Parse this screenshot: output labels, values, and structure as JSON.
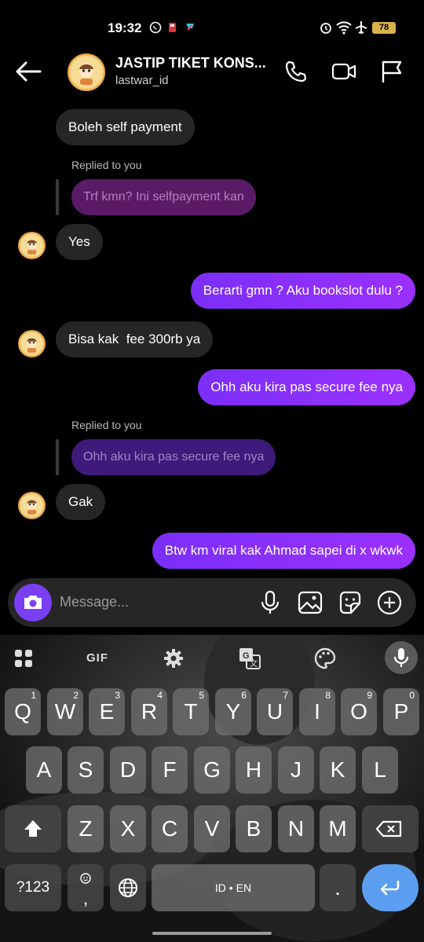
{
  "status_bar": {
    "time": "19:32",
    "battery": "78"
  },
  "header": {
    "title": "JASTIP TIKET KONS...",
    "subtitle": "lastwar_id",
    "icons": [
      "back-arrow-icon",
      "phone-icon",
      "video-icon",
      "flag-icon"
    ]
  },
  "messages": [
    {
      "dir": "in",
      "text": "Boleh self payment"
    },
    {
      "dir": "in",
      "replied_label": "Replied to you",
      "quoted": "Trf kmn? Ini selfpayment kan",
      "text": "Yes"
    },
    {
      "dir": "out",
      "text": "Berarti gmn ? Aku bookslot dulu ?"
    },
    {
      "dir": "in",
      "text": "Bisa kak  fee 300rb ya"
    },
    {
      "dir": "out",
      "text": "Ohh aku kira pas secure fee nya"
    },
    {
      "dir": "in",
      "replied_label": "Replied to you",
      "quoted": "Ohh aku kira pas secure fee nya",
      "text": "Gak"
    },
    {
      "dir": "out",
      "text": "Btw km viral kak Ahmad sapei di x wkwk"
    }
  ],
  "composer": {
    "placeholder": "Message...",
    "icons": [
      "camera-icon",
      "mic-icon",
      "image-icon",
      "sticker-icon",
      "plus-icon"
    ]
  },
  "keyboard": {
    "toolbar": [
      "grid-icon",
      "GIF",
      "gear-icon",
      "translate-icon",
      "palette-icon",
      "mic-icon"
    ],
    "gif_label": "GIF",
    "row1": [
      [
        "Q",
        "1"
      ],
      [
        "W",
        "2"
      ],
      [
        "E",
        "3"
      ],
      [
        "R",
        "4"
      ],
      [
        "T",
        "5"
      ],
      [
        "Y",
        "6"
      ],
      [
        "U",
        "7"
      ],
      [
        "I",
        "8"
      ],
      [
        "O",
        "9"
      ],
      [
        "P",
        "0"
      ]
    ],
    "row2": [
      "A",
      "S",
      "D",
      "F",
      "G",
      "H",
      "J",
      "K",
      "L"
    ],
    "row3": [
      "Z",
      "X",
      "C",
      "V",
      "B",
      "N",
      "M"
    ],
    "symbols_label": "?123",
    "comma_label": ",",
    "space_label": "ID • EN",
    "period_label": "."
  }
}
